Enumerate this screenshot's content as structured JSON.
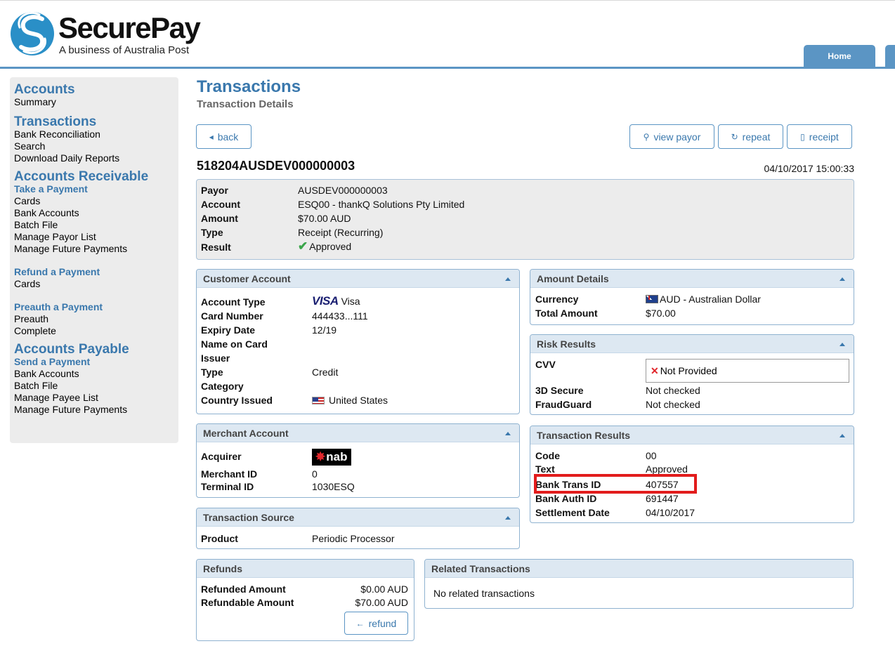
{
  "header": {
    "brand": "SecurePay",
    "tagline": "A business of Australia Post",
    "tabs": [
      {
        "label": "Home"
      }
    ],
    "accent": "#5b95c4"
  },
  "sidebar": {
    "sections": [
      {
        "heading": "Accounts",
        "links": [
          "Summary"
        ]
      },
      {
        "heading": "Transactions",
        "links": [
          "Bank Reconciliation",
          "Search",
          "Download Daily Reports"
        ]
      },
      {
        "heading": "Accounts Receivable",
        "subgroups": [
          {
            "title": "Take a Payment",
            "links": [
              "Cards",
              "Bank Accounts",
              "Batch File",
              "Manage Payor List",
              "Manage Future Payments"
            ]
          },
          {
            "title": "Refund a Payment",
            "links": [
              "Cards"
            ]
          },
          {
            "title": "Preauth a Payment",
            "links": [
              "Preauth",
              "Complete"
            ]
          }
        ]
      },
      {
        "heading": "Accounts Payable",
        "subgroups": [
          {
            "title": "Send a Payment",
            "links": [
              "Bank Accounts",
              "Batch File",
              "Manage Payee List",
              "Manage Future Payments"
            ]
          }
        ]
      }
    ]
  },
  "page": {
    "title": "Transactions",
    "subtitle": "Transaction Details",
    "buttons": {
      "back": "back",
      "view_payor": "view payor",
      "repeat": "repeat",
      "receipt": "receipt",
      "refund": "refund"
    },
    "transaction_id": "518204AUSDEV000000003",
    "datetime": "04/10/2017 15:00:33"
  },
  "summary": [
    {
      "label": "Payor",
      "value": "AUSDEV000000003"
    },
    {
      "label": "Account",
      "value": "ESQ00 - thankQ Solutions Pty Limited"
    },
    {
      "label": "Amount",
      "value": "$70.00 AUD"
    },
    {
      "label": "Type",
      "value": "Receipt (Recurring)"
    },
    {
      "label": "Result",
      "value": "Approved",
      "icon": "check-icon"
    }
  ],
  "customer_account": {
    "title": "Customer Account",
    "card_brand": "VISA",
    "rows": [
      {
        "label": "Account Type",
        "value": "Visa"
      },
      {
        "label": "Card Number",
        "value": "444433...111"
      },
      {
        "label": "Expiry Date",
        "value": "12/19"
      },
      {
        "label": "Name on Card",
        "value": ""
      },
      {
        "label": "Issuer",
        "value": ""
      },
      {
        "label": "Type",
        "value": "Credit"
      },
      {
        "label": "Category",
        "value": ""
      },
      {
        "label": "Country Issued",
        "value": "United States"
      }
    ]
  },
  "merchant_account": {
    "title": "Merchant Account",
    "acquirer_logo": "nab",
    "rows": [
      {
        "label": "Acquirer",
        "value": ""
      },
      {
        "label": "Merchant ID",
        "value": "0"
      },
      {
        "label": "Terminal ID",
        "value": "1030ESQ"
      }
    ]
  },
  "transaction_source": {
    "title": "Transaction Source",
    "rows": [
      {
        "label": "Product",
        "value": "Periodic Processor"
      }
    ]
  },
  "amount_details": {
    "title": "Amount Details",
    "rows": [
      {
        "label": "Currency",
        "value": "AUD - Australian Dollar"
      },
      {
        "label": "Total Amount",
        "value": "$70.00"
      }
    ]
  },
  "risk_results": {
    "title": "Risk Results",
    "rows": [
      {
        "label": "CVV",
        "value": "Not Provided"
      },
      {
        "label": "3D Secure",
        "value": "Not checked"
      },
      {
        "label": "FraudGuard",
        "value": "Not checked"
      }
    ]
  },
  "transaction_results": {
    "title": "Transaction Results",
    "rows": [
      {
        "label": "Code",
        "value": "00"
      },
      {
        "label": "Text",
        "value": "Approved"
      },
      {
        "label": "Bank Trans ID",
        "value": "407557"
      },
      {
        "label": "Bank Auth ID",
        "value": "691447"
      },
      {
        "label": "Settlement Date",
        "value": "04/10/2017"
      }
    ],
    "highlight_color": "#e21c1c"
  },
  "refunds": {
    "title": "Refunds",
    "rows": [
      {
        "label": "Refunded Amount",
        "value": "$0.00 AUD"
      },
      {
        "label": "Refundable Amount",
        "value": "$70.00 AUD"
      }
    ]
  },
  "related_transactions": {
    "title": "Related Transactions",
    "empty_text": "No related transactions"
  }
}
